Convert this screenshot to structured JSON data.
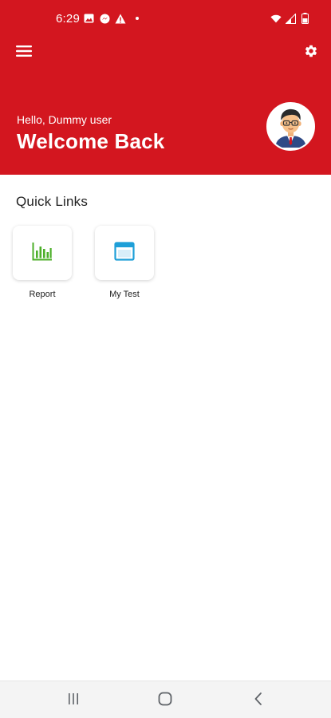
{
  "status_bar": {
    "time": "6:29",
    "left_icons": [
      "image-icon",
      "messenger-icon",
      "warning-icon",
      "dot-icon"
    ],
    "right_icons": [
      "wifi-icon",
      "signal-icon",
      "battery-icon"
    ]
  },
  "header": {
    "greeting": "Hello, Dummy user",
    "title": "Welcome Back",
    "background_color": "#d3161f",
    "menu_icon": "hamburger-menu-icon",
    "settings_icon": "gear-icon",
    "avatar": "avatar"
  },
  "quick_links": {
    "title": "Quick Links",
    "items": [
      {
        "label": "Report",
        "icon": "bar-chart-icon",
        "color": "#4caf2a"
      },
      {
        "label": "My Test",
        "icon": "window-icon",
        "color": "#1e9fd8"
      }
    ]
  },
  "nav_bar": {
    "buttons": [
      "recent-apps-icon",
      "home-icon",
      "back-icon"
    ]
  }
}
